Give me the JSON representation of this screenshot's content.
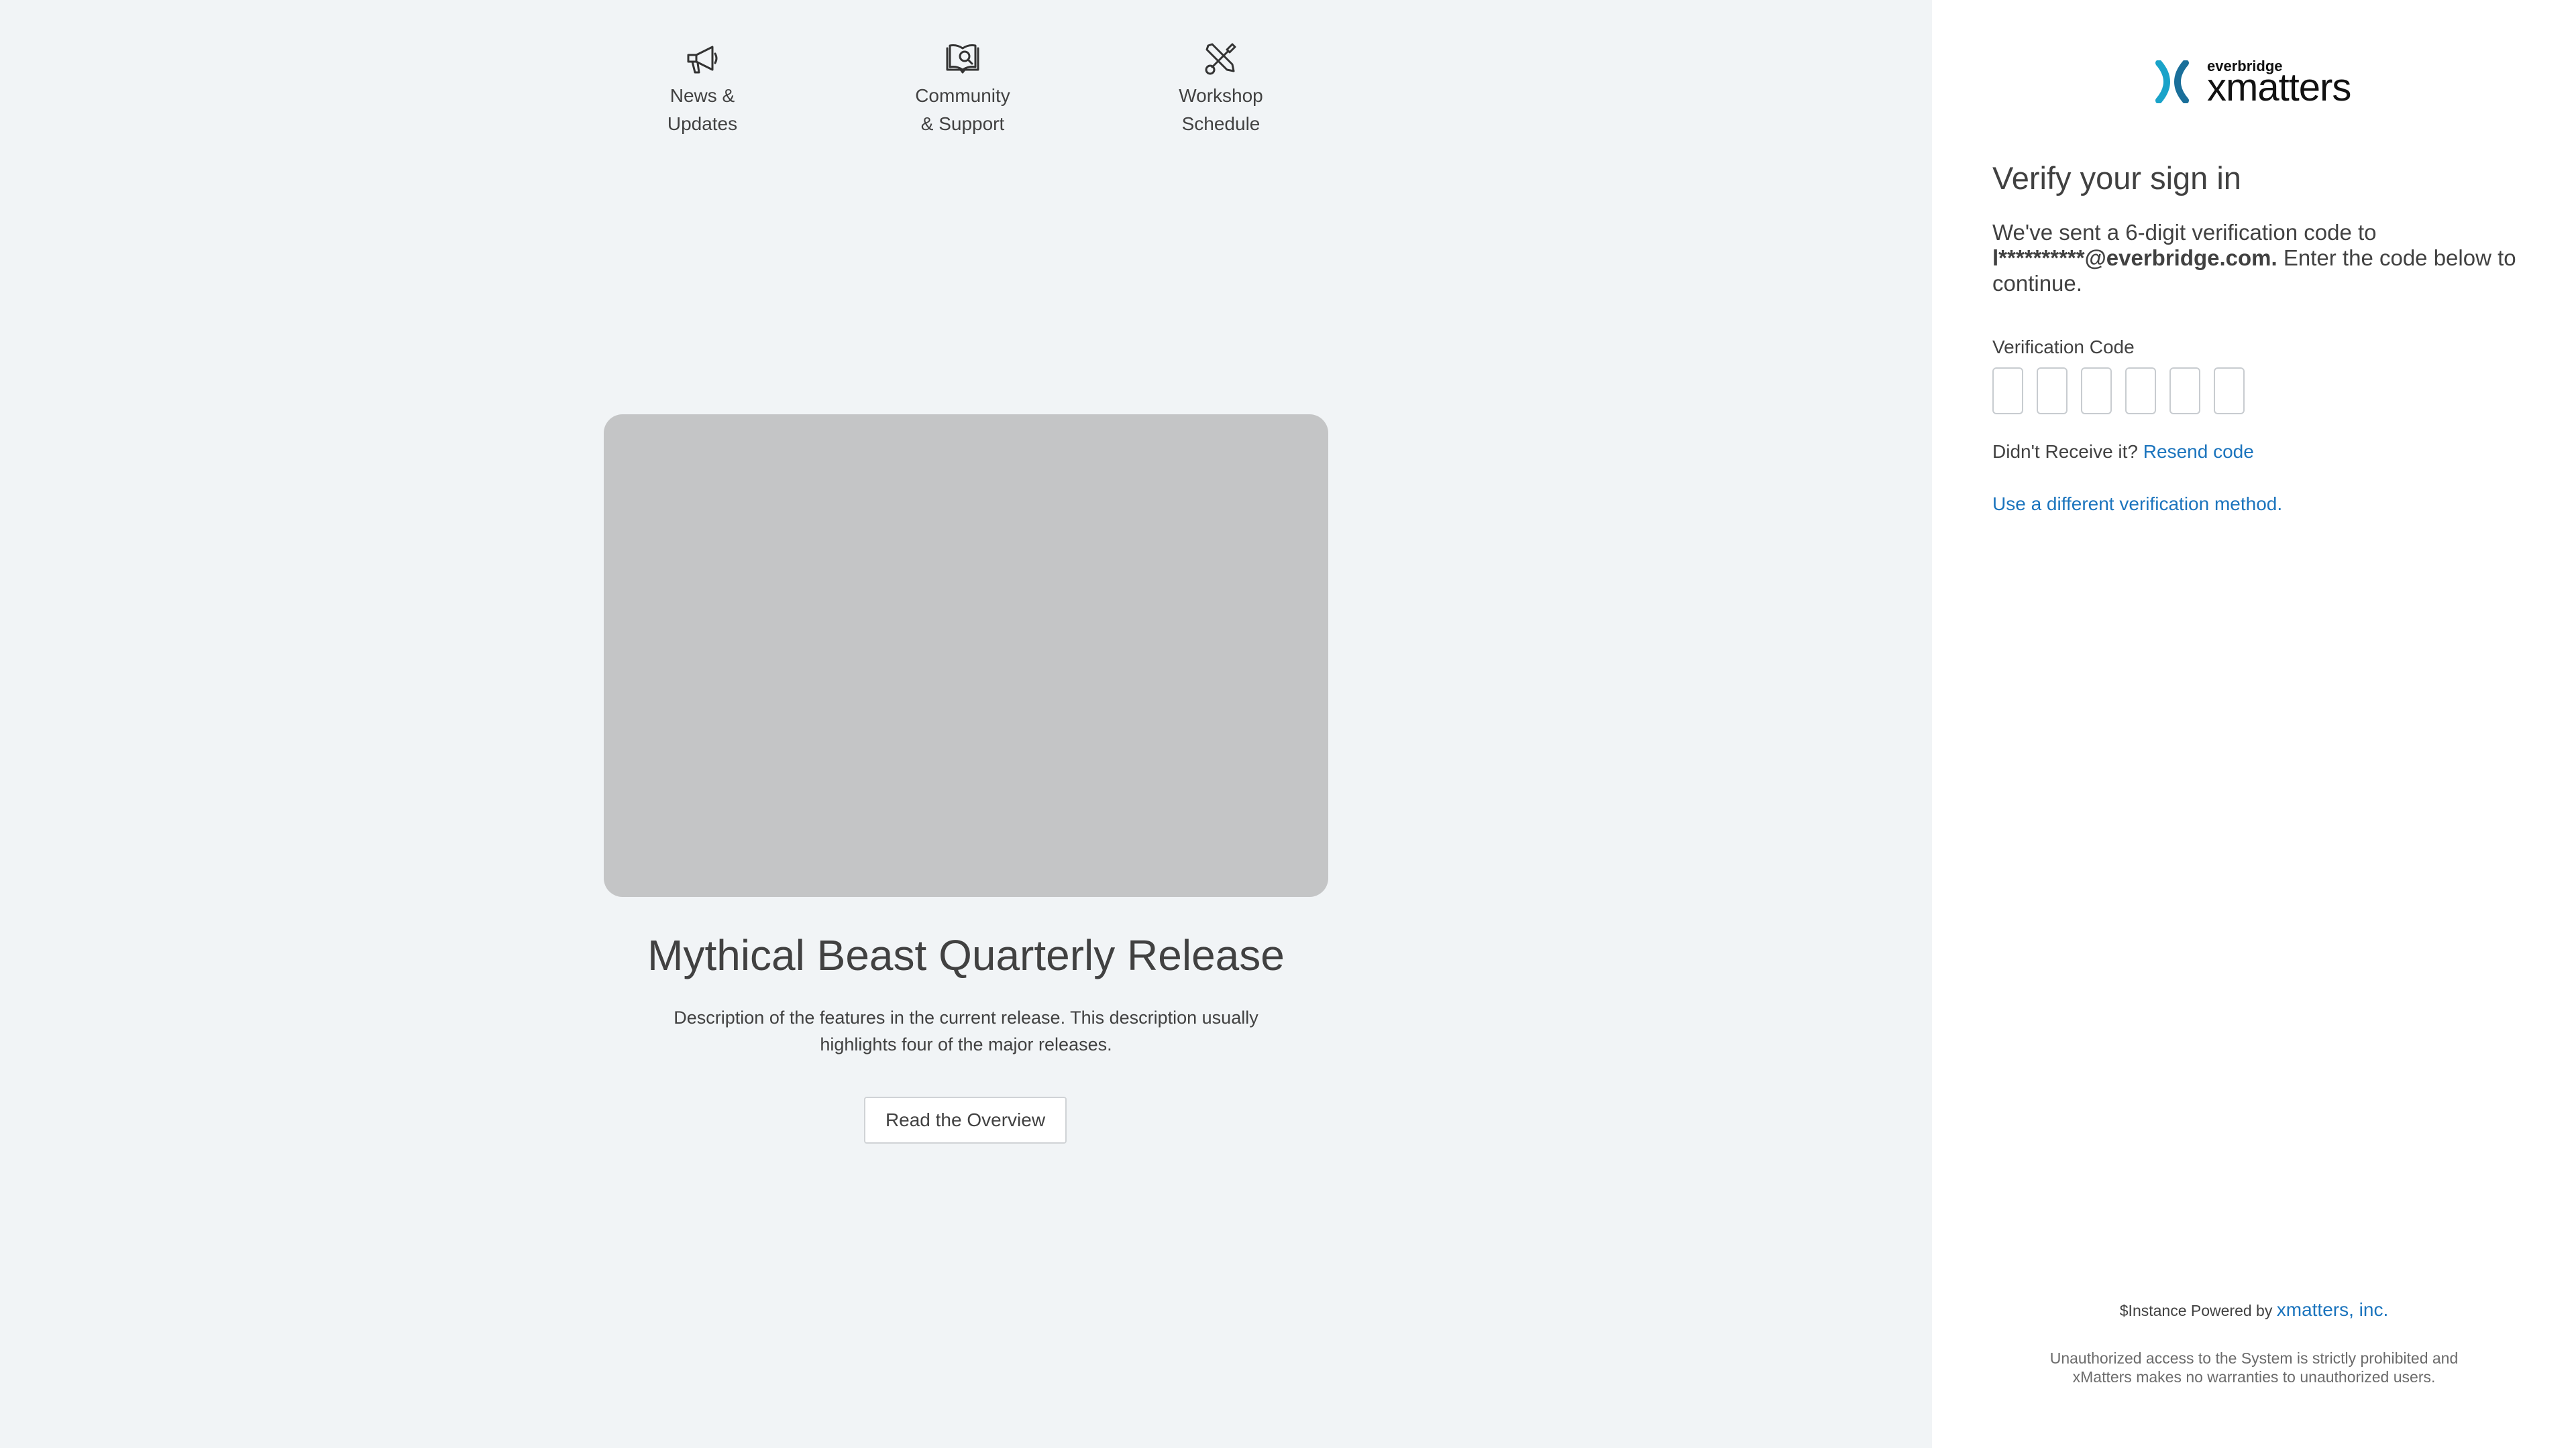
{
  "quicklinks": [
    {
      "label": "News &\nUpdates",
      "icon": "megaphone-icon"
    },
    {
      "label": "Community\n& Support",
      "icon": "book-search-icon"
    },
    {
      "label": "Workshop\nSchedule",
      "icon": "tools-icon"
    }
  ],
  "hero": {
    "title": "Mythical Beast Quarterly Release",
    "description": "Description of the features in the current release. This description usually highlights four of the major releases.",
    "button_label": "Read the Overview"
  },
  "panel": {
    "logo_small": "everbridge",
    "logo_big": "xmatters",
    "title": "Verify your sign in",
    "body_prefix": "We've sent a 6-digit verification code to",
    "masked_email": "l**********@everbridge.com.",
    "body_suffix": "Enter the code below to continue.",
    "code_label": "Verification Code",
    "code_digits": 6,
    "resend_prefix": "Didn't Receive it?",
    "resend_link": "Resend code",
    "alt_method_link": "Use a different verification method.",
    "powered_prefix": "$Instance Powered by",
    "powered_link": "xmatters, inc.",
    "legal": "Unauthorized access to the System is strictly prohibited and xMatters makes no warranties to unauthorized users."
  },
  "colors": {
    "background": "#f1f4f6",
    "panel": "#ffffff",
    "link": "#1b74bd",
    "text": "#414141",
    "placeholder_image": "#c4c5c6",
    "logo_teal": "#1aa3c9"
  }
}
